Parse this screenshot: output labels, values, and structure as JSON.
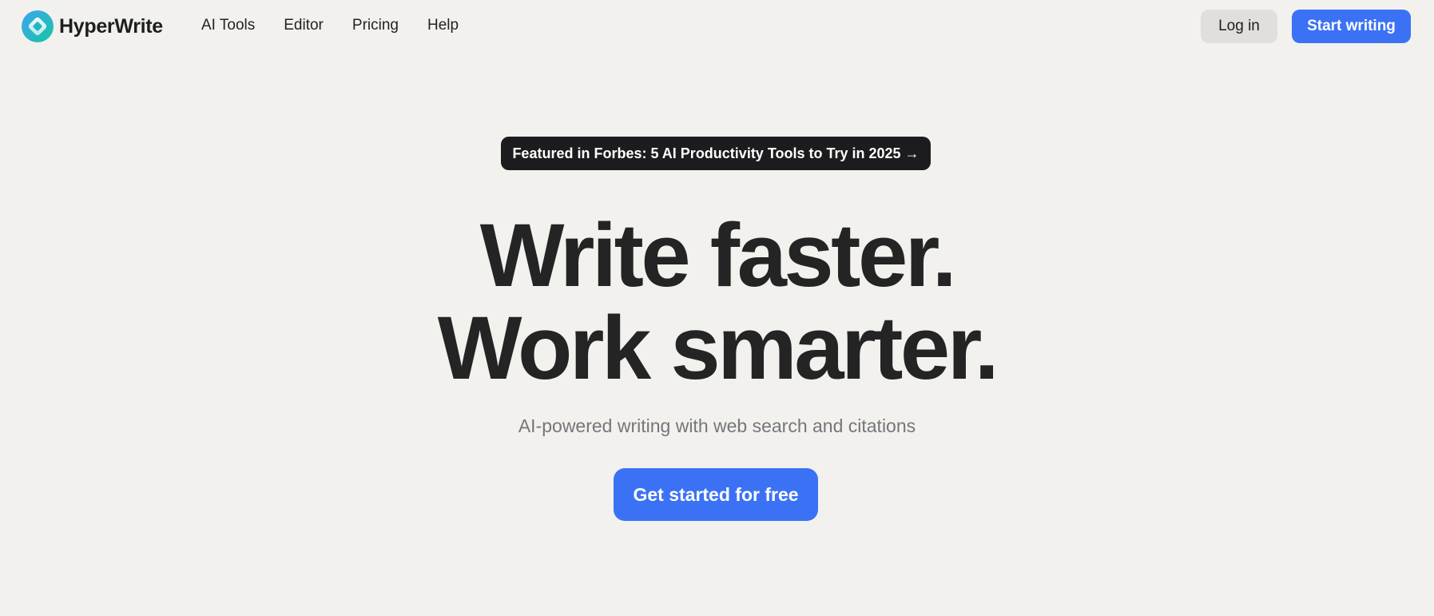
{
  "header": {
    "brand": "HyperWrite",
    "logo_icon": "hyperwrite-diamond-logo",
    "nav": [
      {
        "label": "AI Tools"
      },
      {
        "label": "Editor"
      },
      {
        "label": "Pricing"
      },
      {
        "label": "Help"
      }
    ],
    "login_label": "Log in",
    "start_label": "Start writing"
  },
  "hero": {
    "badge": "Featured in Forbes: 5 AI Productivity Tools to Try in 2025 →",
    "headline_line1": "Write faster.",
    "headline_line2": "Work smarter.",
    "subtitle": "AI-powered writing with web search and citations",
    "cta_label": "Get started for free"
  },
  "colors": {
    "background": "#f2f1ee",
    "accent": "#3b72f5",
    "badge_bg": "#1c1c1e",
    "text": "#242424",
    "muted": "#76757a"
  }
}
